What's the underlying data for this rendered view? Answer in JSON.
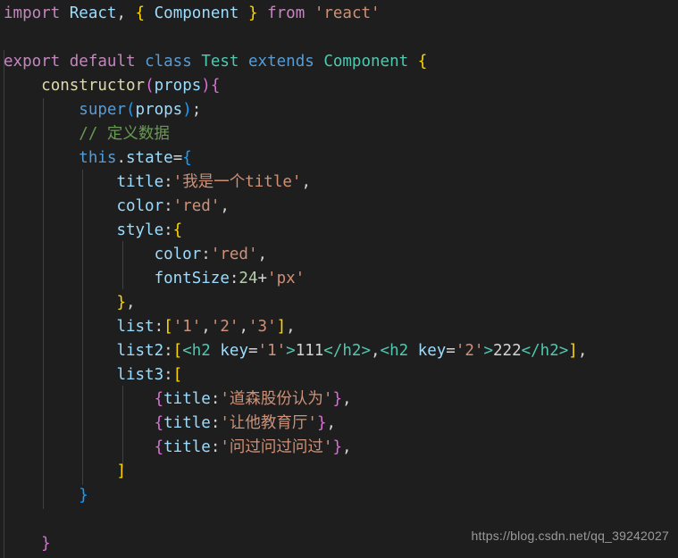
{
  "editor": {
    "background_color": "#1e1e1e",
    "default_text_color": "#d4d4d4",
    "font_size_px": 17.5,
    "line_height_px": 27,
    "language": "javascript-jsx"
  },
  "palette": {
    "keyword_control": "#c586c0",
    "keyword": "#569cd6",
    "type": "#4ec9b0",
    "identifier": "#9cdcfe",
    "function": "#dcdcaa",
    "string": "#ce9178",
    "number": "#b5cea8",
    "comment": "#6a9955",
    "punctuation": "#d4d4d4",
    "bracket_level_1": "#ffd700",
    "bracket_level_2": "#da70d6",
    "bracket_level_3": "#179fff",
    "indent_guide": "#404040"
  },
  "code": {
    "lines": [
      "import React, { Component } from 'react'",
      "",
      "export default class Test extends Component {",
      "    constructor(props){",
      "        super(props);",
      "        // 定义数据",
      "        this.state={",
      "            title:'我是一个title',",
      "            color:'red',",
      "            style:{",
      "                color:'red',",
      "                fontSize:24+'px'",
      "            },",
      "            list:['1','2','3'],",
      "            list2:[<h2 key='1'>111</h2>,<h2 key='2'>222</h2>],",
      "            list3:[",
      "                {title:'道森股份认为'},",
      "                {title:'让他教育厅'},",
      "                {title:'问过问过问过'},",
      "            ]",
      "        }",
      "",
      "    }"
    ],
    "tokens": {
      "import": "import",
      "react_ident": "React",
      "component_ident": "Component",
      "from": "from",
      "react_module_string": "'react'",
      "export": "export",
      "default": "default",
      "class": "class",
      "class_name": "Test",
      "extends": "extends",
      "base_class": "Component",
      "constructor": "constructor",
      "props": "props",
      "super": "super",
      "comment": "// 定义数据",
      "this": "this",
      "state": "state",
      "prop_title": "title",
      "prop_color": "color",
      "prop_style": "style",
      "prop_fontsize": "fontSize",
      "prop_list": "list",
      "prop_list2": "list2",
      "prop_list3": "list3",
      "string_title": "'我是一个title'",
      "string_red": "'red'",
      "number_24": "24",
      "string_px": "'px'",
      "string_1": "'1'",
      "string_2": "'2'",
      "string_3": "'3'",
      "jsx_tag_open": "<h2",
      "jsx_attr_key": "key",
      "jsx_key_1": "'1'",
      "jsx_key_2": "'2'",
      "jsx_text_111": "111",
      "jsx_text_222": "222",
      "jsx_tag_close": "</h2>",
      "string_cn_1": "'道森股份认为'",
      "string_cn_2": "'让他教育厅'",
      "string_cn_3": "'问过问过问过'"
    }
  },
  "watermark": {
    "text": "https://blog.csdn.net/qq_39242027"
  }
}
